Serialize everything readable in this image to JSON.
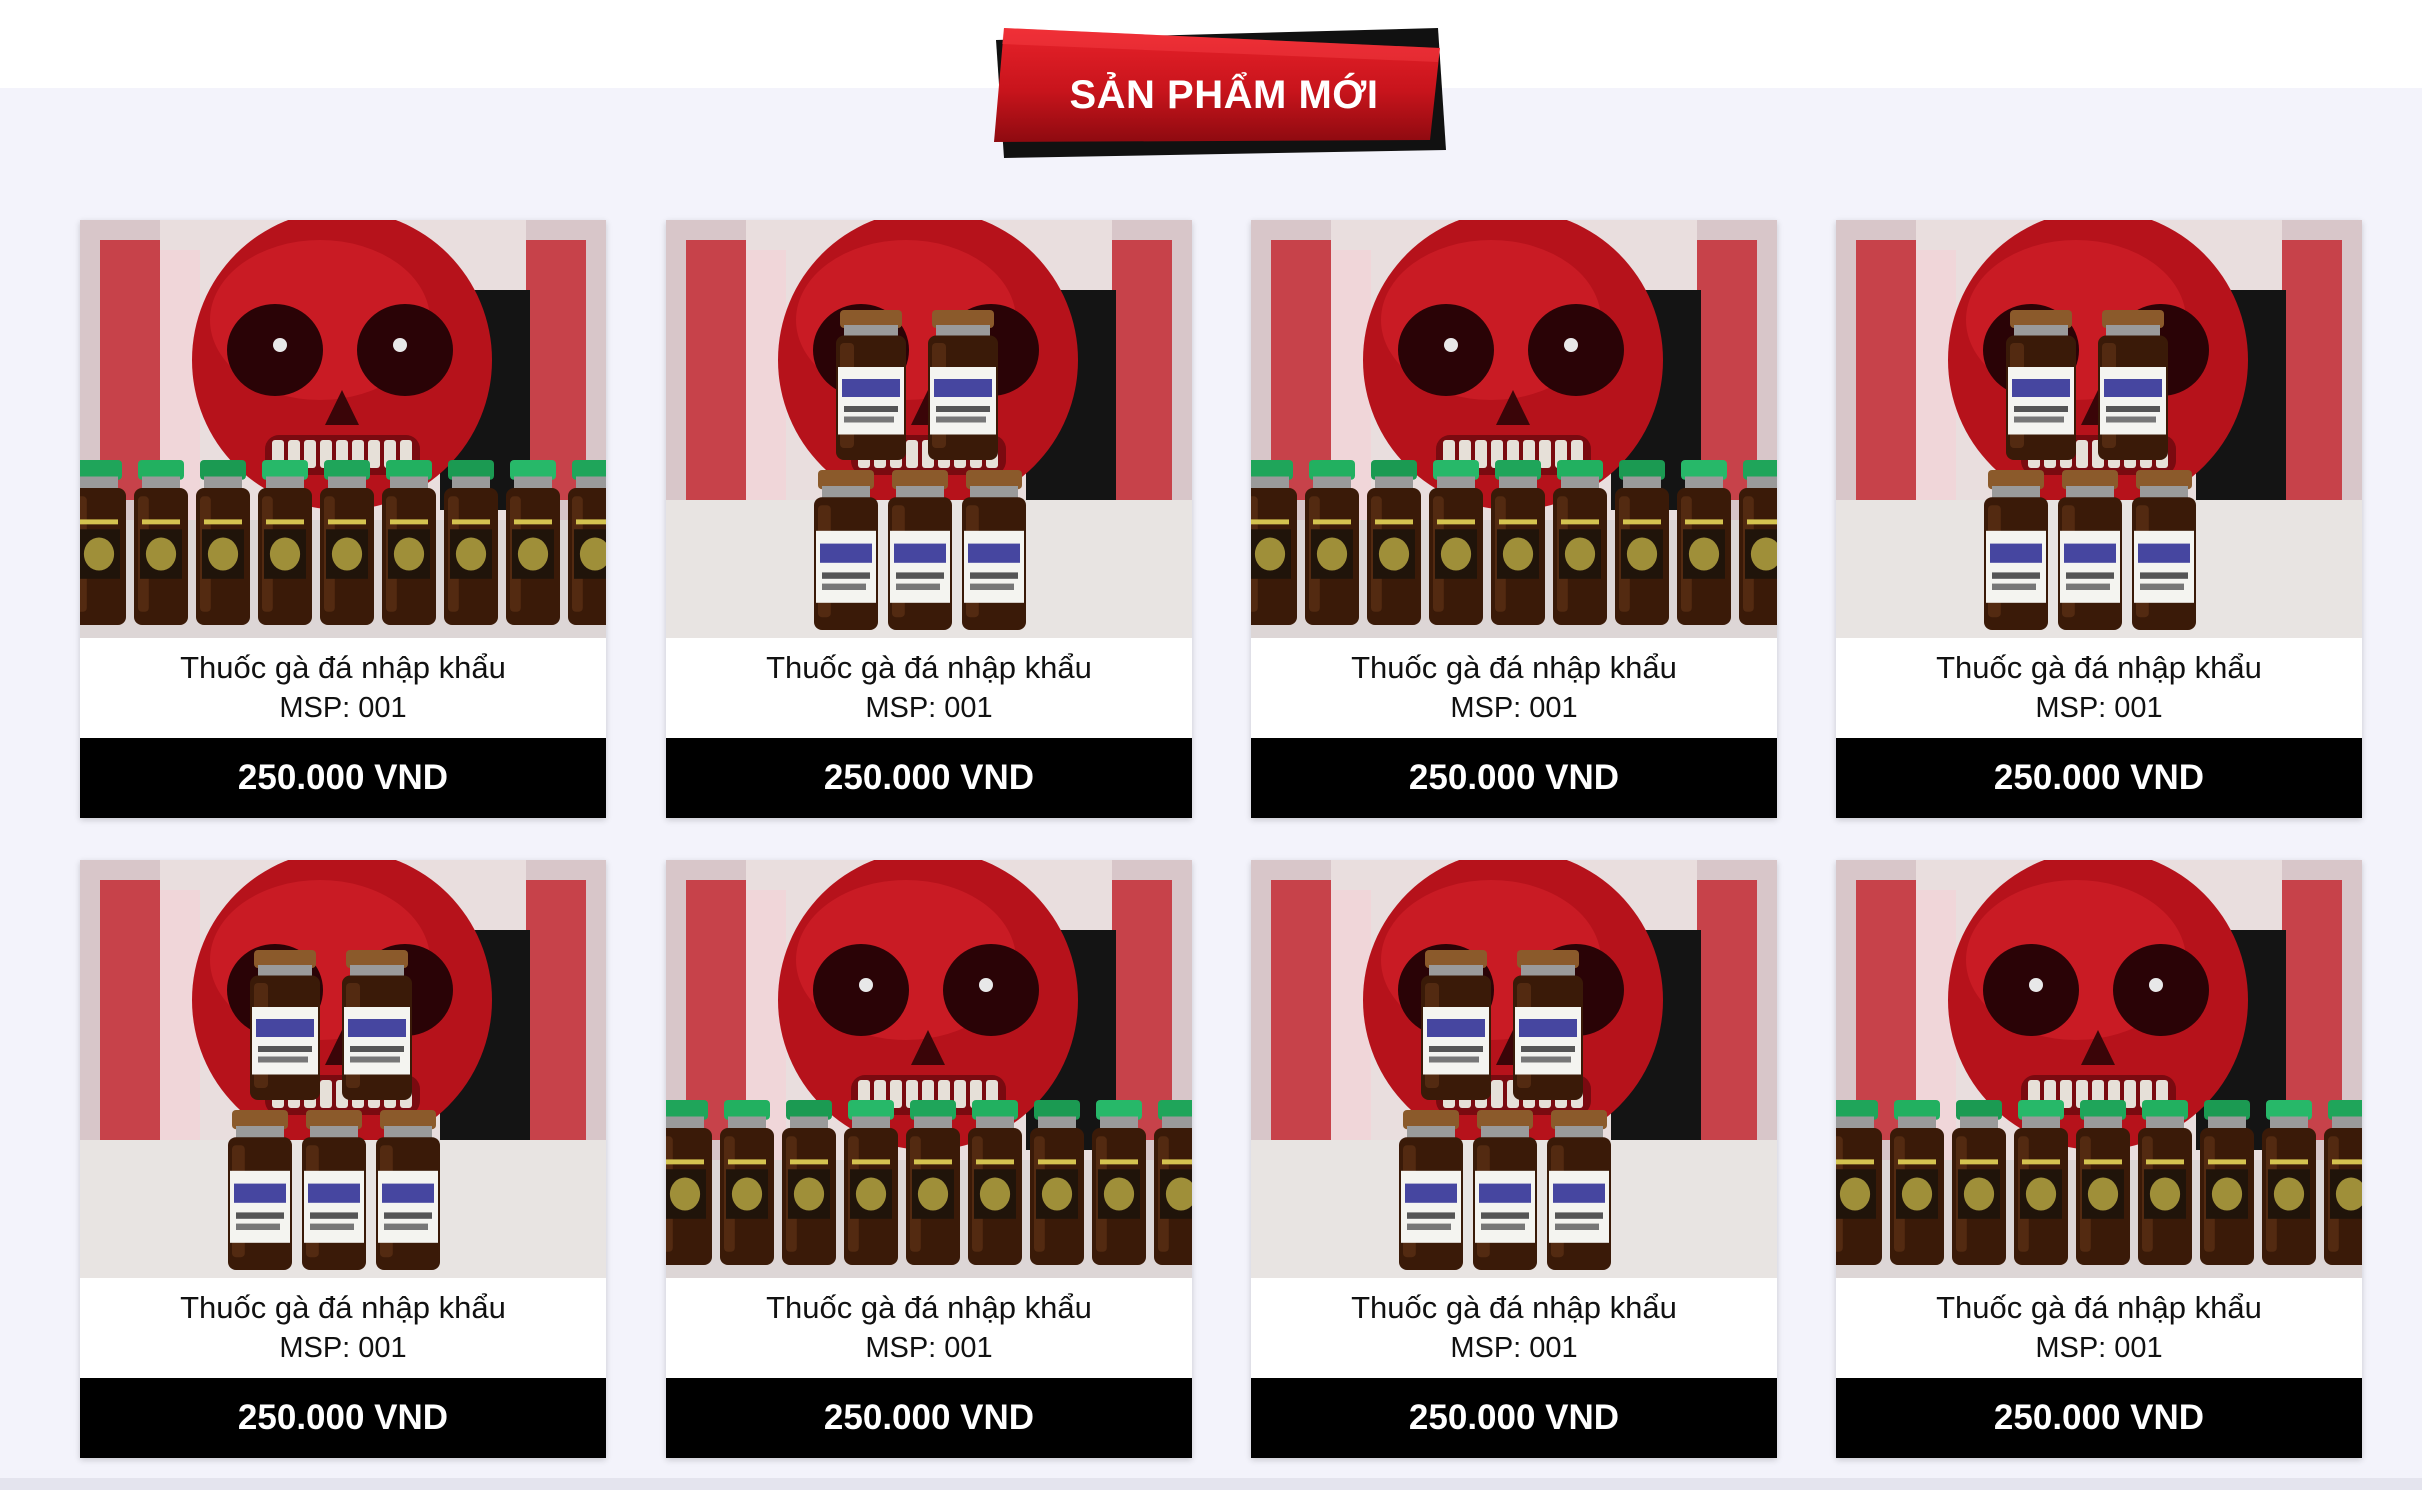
{
  "section": {
    "title": "SẢN PHẨM MỚI",
    "accent_color": "#c8141c"
  },
  "products": [
    {
      "name": "Thuốc gà đá nhập khẩu",
      "code": "MSP: 001",
      "price": "250.000 VND",
      "image": "skull-vials-row"
    },
    {
      "name": "Thuốc gà đá nhập khẩu",
      "code": "MSP: 001",
      "price": "250.000 VND",
      "image": "cardoxin-vials-stack"
    },
    {
      "name": "Thuốc gà đá nhập khẩu",
      "code": "MSP: 001",
      "price": "250.000 VND",
      "image": "skull-vials-row"
    },
    {
      "name": "Thuốc gà đá nhập khẩu",
      "code": "MSP: 001",
      "price": "250.000 VND",
      "image": "cardoxin-vials-stack"
    },
    {
      "name": "Thuốc gà đá nhập khẩu",
      "code": "MSP: 001",
      "price": "250.000 VND",
      "image": "cardoxin-vials-stack"
    },
    {
      "name": "Thuốc gà đá nhập khẩu",
      "code": "MSP: 001",
      "price": "250.000 VND",
      "image": "skull-vials-row"
    },
    {
      "name": "Thuốc gà đá nhập khẩu",
      "code": "MSP: 001",
      "price": "250.000 VND",
      "image": "cardoxin-vials-stack"
    },
    {
      "name": "Thuốc gà đá nhập khẩu",
      "code": "MSP: 001",
      "price": "250.000 VND",
      "image": "skull-vials-row"
    }
  ]
}
